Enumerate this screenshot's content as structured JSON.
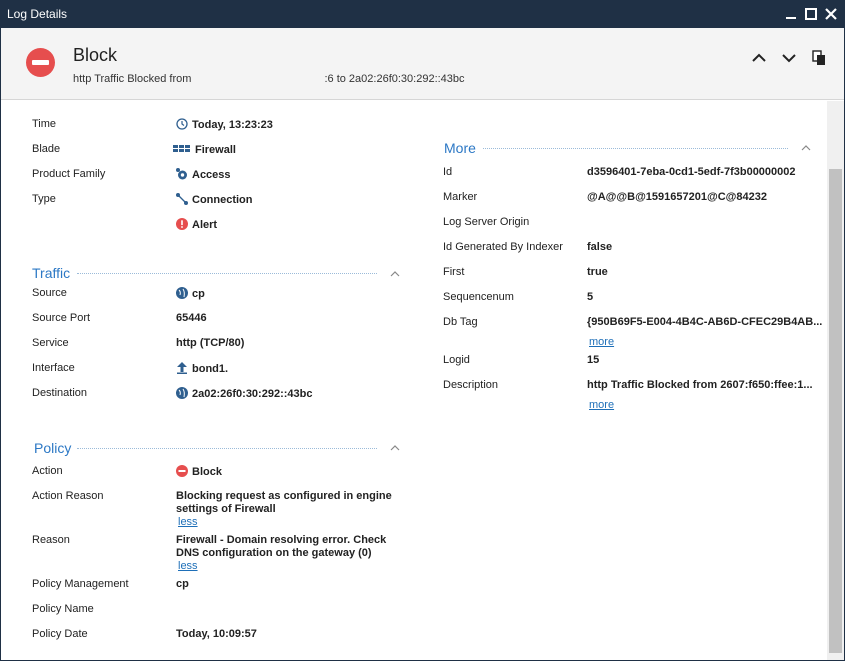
{
  "window": {
    "title": "Log Details"
  },
  "header": {
    "title": "Block",
    "subtitle_prefix": "http Traffic Blocked from ",
    "subtitle_redacted_tail": ":6 to 2a02:26f0:30:292::43bc"
  },
  "details": {
    "time_label": "Time",
    "time_value": "Today, 13:23:23",
    "blade_label": "Blade",
    "blade_value": "Firewall",
    "family_label": "Product Family",
    "family_value": "Access",
    "type_label": "Type",
    "type_value": "Connection",
    "type_value2": "Alert"
  },
  "traffic": {
    "title": "Traffic",
    "source_label": "Source",
    "source_value": "cp",
    "port_label": "Source Port",
    "port_value": "65446",
    "service_label": "Service",
    "service_value": "http (TCP/80)",
    "interface_label": "Interface",
    "interface_value": "bond1.",
    "destination_label": "Destination",
    "destination_value": "2a02:26f0:30:292::43bc"
  },
  "policy": {
    "title": "Policy",
    "action_label": "Action",
    "action_value": "Block",
    "action_reason_label": "Action Reason",
    "action_reason_value": "Blocking request as configured in engine settings of Firewall",
    "less1": "less",
    "reason_label": "Reason",
    "reason_value": "Firewall  -  Domain resolving error. Check DNS configuration on the gateway (0)",
    "less2": "less",
    "mgmt_label": "Policy Management",
    "mgmt_value": "cp",
    "name_label": "Policy Name",
    "name_value": "",
    "date_label": "Policy Date",
    "date_value": "Today, 10:09:57"
  },
  "more": {
    "title": "More",
    "id_label": "Id",
    "id_value": "d3596401-7eba-0cd1-5edf-7f3b00000002",
    "marker_label": "Marker",
    "marker_value": "@A@@B@1591657201@C@84232",
    "origin_label": "Log Server Origin",
    "origin_value": "",
    "indexer_label": "Id Generated By Indexer",
    "indexer_value": "false",
    "first_label": "First",
    "first_value": "true",
    "seq_label": "Sequencenum",
    "seq_value": "5",
    "dbtag_label": "Db Tag",
    "dbtag_value": "{950B69F5-E004-4B4C-AB6D-CFEC29B4AB...",
    "more1": "more",
    "logid_label": "Logid",
    "logid_value": "15",
    "desc_label": "Description",
    "desc_value": "http Traffic Blocked from 2607:f650:ffee:1...",
    "more2": "more"
  },
  "icons": {
    "block": "block-icon",
    "clock": "clock-icon",
    "firewall": "firewall-icon",
    "access": "access-icon",
    "connection": "connection-icon",
    "alert": "alert-icon",
    "globe": "globe-icon",
    "interface": "upload-arrow-icon"
  },
  "colors": {
    "titlebar": "#1f3045",
    "accent": "#2c78c5",
    "block": "#e64e4e",
    "link": "#1e6fb8"
  }
}
